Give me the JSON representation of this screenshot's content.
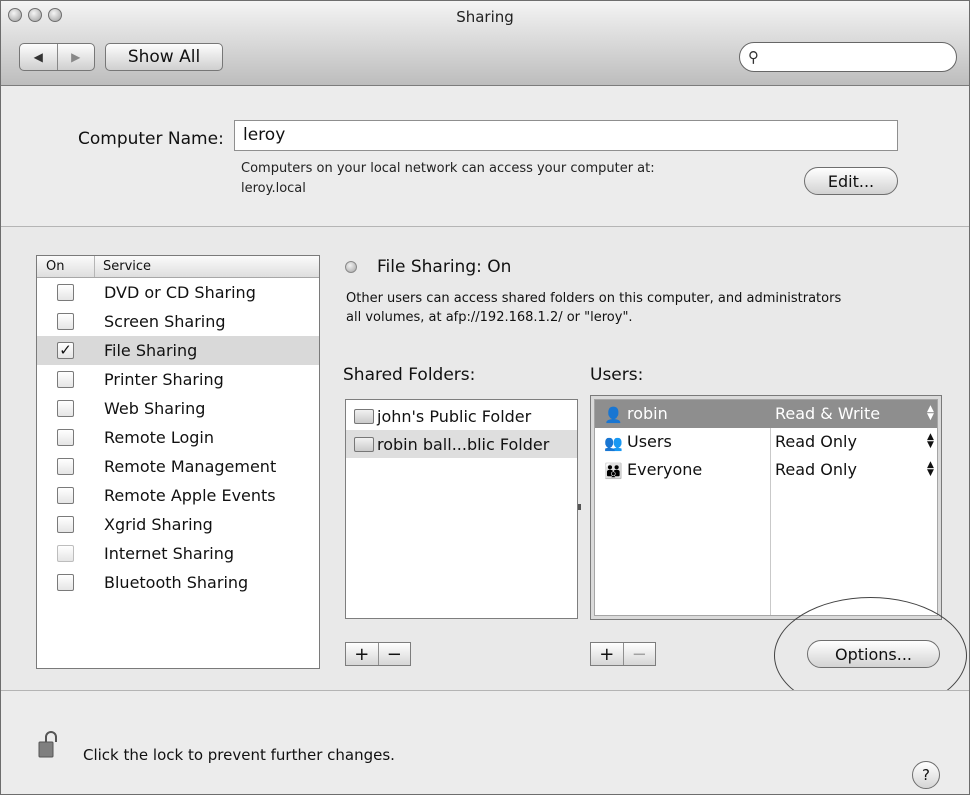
{
  "window": {
    "title": "Sharing"
  },
  "toolbar": {
    "back_glyph": "◀",
    "forward_glyph": "▶",
    "show_all_label": "Show All",
    "search_icon": "search-icon",
    "search_value": ""
  },
  "computer_name": {
    "label": "Computer Name:",
    "value": "leroy",
    "description_line1": "Computers on your local network can access your computer at:",
    "description_line2": "leroy.local",
    "edit_label": "Edit..."
  },
  "service_list": {
    "headers": {
      "on": "On",
      "service": "Service"
    },
    "items": [
      {
        "name": "DVD or CD Sharing",
        "checked": false
      },
      {
        "name": "Screen Sharing",
        "checked": false
      },
      {
        "name": "File Sharing",
        "checked": true,
        "selected": true
      },
      {
        "name": "Printer Sharing",
        "checked": false
      },
      {
        "name": "Web Sharing",
        "checked": false
      },
      {
        "name": "Remote Login",
        "checked": false
      },
      {
        "name": "Remote Management",
        "checked": false
      },
      {
        "name": "Remote Apple Events",
        "checked": false
      },
      {
        "name": "Xgrid Sharing",
        "checked": false
      },
      {
        "name": "Internet Sharing",
        "checked": false,
        "disabled": true
      },
      {
        "name": "Bluetooth Sharing",
        "checked": false
      }
    ]
  },
  "detail": {
    "status_title": "File Sharing: On",
    "status_desc_line1": "Other users can access shared folders on this computer, and administrators",
    "status_desc_line2": "all volumes, at afp://192.168.1.2/ or \"leroy\".",
    "shared_folders_label": "Shared Folders:",
    "users_label": "Users:",
    "folders": [
      {
        "name": "john's Public Folder"
      },
      {
        "name": "robin ball...blic Folder",
        "selected": true
      }
    ],
    "users": [
      {
        "name": "robin",
        "permission": "Read & Write",
        "selected": true,
        "icon": "single-user-icon"
      },
      {
        "name": "Users",
        "permission": "Read Only",
        "icon": "group-icon"
      },
      {
        "name": "Everyone",
        "permission": "Read Only",
        "icon": "everyone-icon"
      }
    ],
    "add_label": "+",
    "remove_label": "−",
    "options_label": "Options..."
  },
  "footer": {
    "lock_text": "Click the lock to prevent further changes.",
    "help_label": "?"
  }
}
